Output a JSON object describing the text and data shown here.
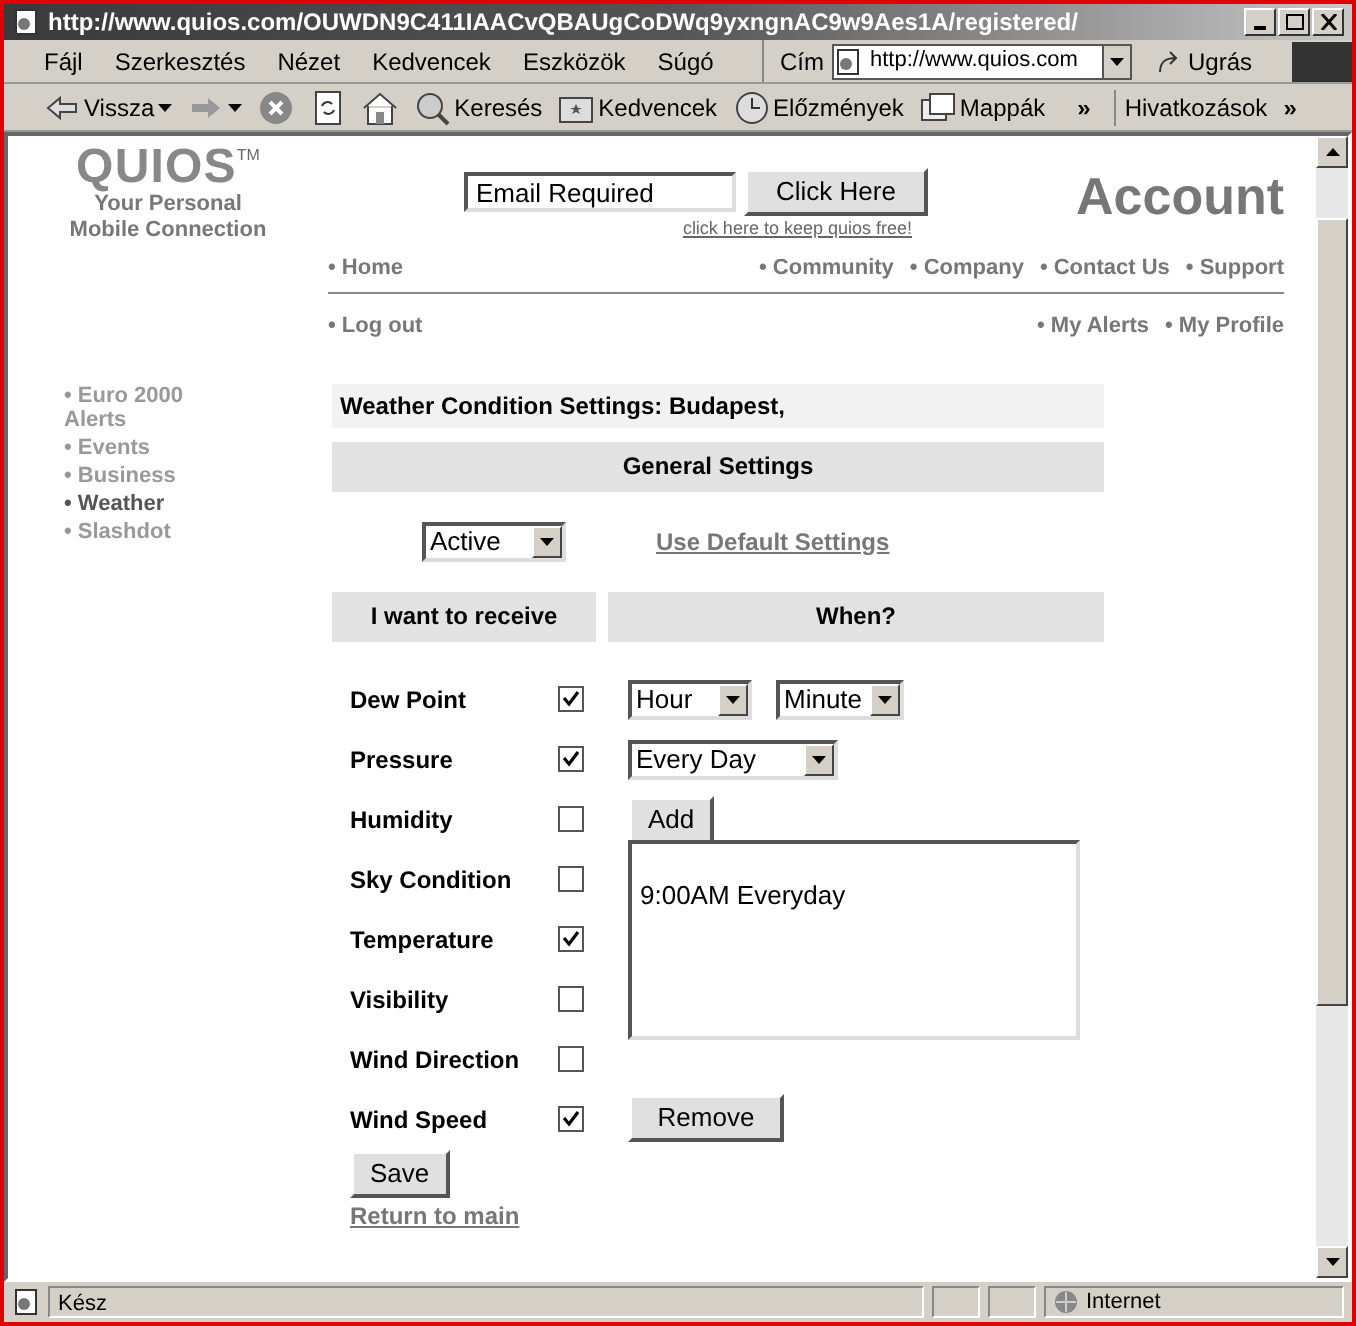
{
  "window": {
    "title": "http://www.quios.com/OUWDN9C411IAACvQBAUgCoDWq9yxngnAC9w9Aes1A/registered/"
  },
  "menu": [
    {
      "label": "Fájl"
    },
    {
      "label": "Szerkesztés"
    },
    {
      "label": "Nézet"
    },
    {
      "label": "Kedvencek"
    },
    {
      "label": "Eszközök"
    },
    {
      "label": "Súgó"
    }
  ],
  "address": {
    "label": "Cím",
    "value": "http://www.quios.com",
    "go": "Ugrás"
  },
  "toolbar": [
    {
      "kind": "back",
      "label": "Vissza"
    },
    {
      "kind": "forward"
    },
    {
      "kind": "stop"
    },
    {
      "kind": "refresh"
    },
    {
      "kind": "home"
    },
    {
      "kind": "search",
      "label": "Keresés"
    },
    {
      "kind": "favorites",
      "label": "Kedvencek"
    },
    {
      "kind": "history",
      "label": "Előzmények"
    },
    {
      "kind": "folders",
      "label": "Mappák"
    }
  ],
  "more": "»",
  "links": {
    "label": "Hivatkozások",
    "more": "»"
  },
  "logo": {
    "name": "QUIOS",
    "tm": "TM",
    "tagline": "Your Personal Mobile Connection"
  },
  "signup": {
    "placeholder": "Email Required",
    "button": "Click Here",
    "link": "click here to keep quios free!",
    "account": "Account"
  },
  "nav_left": [
    "• Home",
    "• Log out"
  ],
  "nav_right": [
    [
      "• Community",
      "• Company",
      "• Contact Us",
      "• Support"
    ],
    [
      "• My Alerts",
      "• My Profile"
    ]
  ],
  "sidebar": {
    "items": [
      {
        "label": "• Euro 2000 Alerts",
        "selected": false
      },
      {
        "label": "• Events",
        "selected": false
      },
      {
        "label": "• Business",
        "selected": false
      },
      {
        "label": "• Weather",
        "selected": true
      },
      {
        "label": "• Slashdot",
        "selected": false
      }
    ]
  },
  "form": {
    "title": "Weather Condition Settings: Budapest,",
    "general": "General Settings",
    "status": "Active",
    "default_link": "Use Default Settings",
    "col_receive": "I want to receive",
    "col_when": "When?",
    "conditions": [
      {
        "label": "Dew Point",
        "checked": true
      },
      {
        "label": "Pressure",
        "checked": true
      },
      {
        "label": "Humidity",
        "checked": false
      },
      {
        "label": "Sky Condition",
        "checked": false
      },
      {
        "label": "Temperature",
        "checked": true
      },
      {
        "label": "Visibility",
        "checked": false
      },
      {
        "label": "Wind Direction",
        "checked": false
      },
      {
        "label": "Wind Speed",
        "checked": true
      }
    ],
    "hour": "Hour",
    "minute": "Minute",
    "frequency": "Every Day",
    "add": "Add",
    "schedules": [
      "9:00AM Everyday"
    ],
    "remove": "Remove",
    "save": "Save",
    "return": "Return to main"
  },
  "status_bar": {
    "text": "Kész",
    "zone": "Internet"
  }
}
